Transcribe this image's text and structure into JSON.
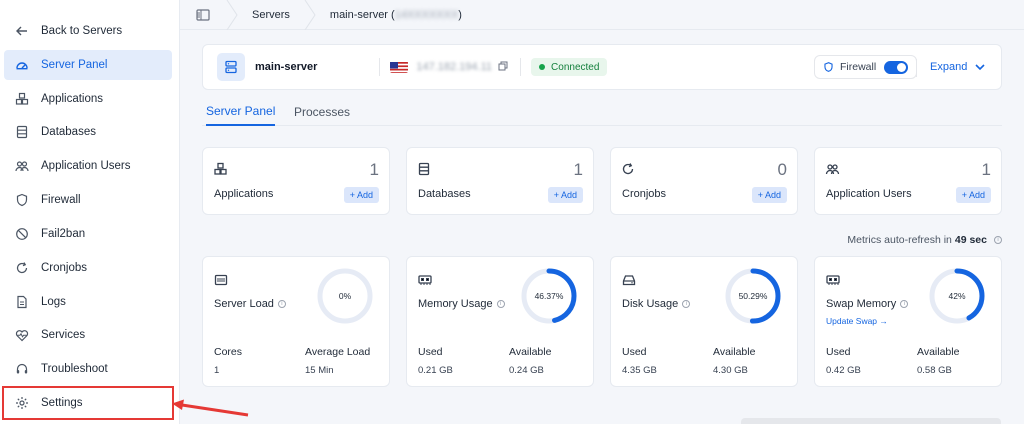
{
  "sidebar": {
    "items": [
      {
        "label": "Back to Servers",
        "icon": "arrow-left-icon"
      },
      {
        "label": "Server Panel",
        "icon": "speedometer-icon",
        "active": true
      },
      {
        "label": "Applications",
        "icon": "cubes-icon"
      },
      {
        "label": "Databases",
        "icon": "database-icon"
      },
      {
        "label": "Application Users",
        "icon": "users-icon"
      },
      {
        "label": "Firewall",
        "icon": "shield-icon"
      },
      {
        "label": "Fail2ban",
        "icon": "ban-icon"
      },
      {
        "label": "Cronjobs",
        "icon": "refresh-icon"
      },
      {
        "label": "Logs",
        "icon": "file-icon"
      },
      {
        "label": "Services",
        "icon": "heartbeat-icon"
      },
      {
        "label": "Troubleshoot",
        "icon": "headset-icon"
      },
      {
        "label": "Settings",
        "icon": "gear-icon",
        "highlighted": true
      }
    ]
  },
  "breadcrumb": {
    "servers": "Servers",
    "current": "main-server (",
    "current_hidden": "14XXXXXXX",
    "current_close": ")"
  },
  "header": {
    "server_name": "main-server",
    "ip": "147.182.194.11",
    "status": "Connected",
    "firewall_label": "Firewall",
    "firewall_on": true,
    "expand_label": "Expand"
  },
  "tabs": [
    {
      "label": "Server Panel",
      "active": true
    },
    {
      "label": "Processes",
      "active": false
    }
  ],
  "stats": [
    {
      "label": "Applications",
      "count": "1",
      "add": "+ Add",
      "icon": "cubes-icon"
    },
    {
      "label": "Databases",
      "count": "1",
      "add": "+ Add",
      "icon": "database-icon"
    },
    {
      "label": "Cronjobs",
      "count": "0",
      "add": "+ Add",
      "icon": "refresh-icon"
    },
    {
      "label": "Application Users",
      "count": "1",
      "add": "+ Add",
      "icon": "users-icon"
    }
  ],
  "refresh": {
    "prefix": "Metrics auto-refresh in",
    "value": "49 sec"
  },
  "metrics": [
    {
      "label": "Server Load",
      "icon": "cpu-icon",
      "percent": 0,
      "percent_label": "0%",
      "col1_h": "Cores",
      "col1_v": "1",
      "col2_h": "Average Load",
      "col2_v": "15 Min",
      "link": ""
    },
    {
      "label": "Memory Usage",
      "icon": "memory-icon",
      "percent": 46.37,
      "percent_label": "46.37%",
      "col1_h": "Used",
      "col1_v": "0.21 GB",
      "col2_h": "Available",
      "col2_v": "0.24 GB",
      "link": ""
    },
    {
      "label": "Disk Usage",
      "icon": "hdd-icon",
      "percent": 50.29,
      "percent_label": "50.29%",
      "col1_h": "Used",
      "col1_v": "4.35 GB",
      "col2_h": "Available",
      "col2_v": "4.30 GB",
      "link": ""
    },
    {
      "label": "Swap Memory",
      "icon": "memory-icon",
      "percent": 42,
      "percent_label": "42%",
      "col1_h": "Used",
      "col1_v": "0.42 GB",
      "col2_h": "Available",
      "col2_v": "0.58 GB",
      "link": "Update Swap →"
    }
  ],
  "colors": {
    "accent": "#1565e0",
    "donut_track": "#e6ebf5",
    "highlight": "#e53935",
    "connected": "#16a34a"
  }
}
